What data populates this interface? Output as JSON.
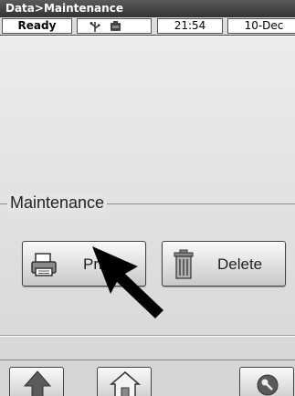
{
  "window": {
    "title": "Data>Maintenance"
  },
  "status": {
    "state": "Ready",
    "icons": [
      "usb-icon",
      "battery-icon"
    ],
    "time": "21:54",
    "date": "10-Dec"
  },
  "maintenance": {
    "group_title": "Maintenance",
    "print_label": "Print",
    "delete_label": "Delete"
  },
  "nav": {
    "icons": [
      "up-arrow-icon",
      "home-icon",
      "tools-icon"
    ]
  },
  "colors": {
    "title_bar": "#3a3a3a",
    "panel": "#e4e4e4",
    "pointer": "#000000"
  }
}
